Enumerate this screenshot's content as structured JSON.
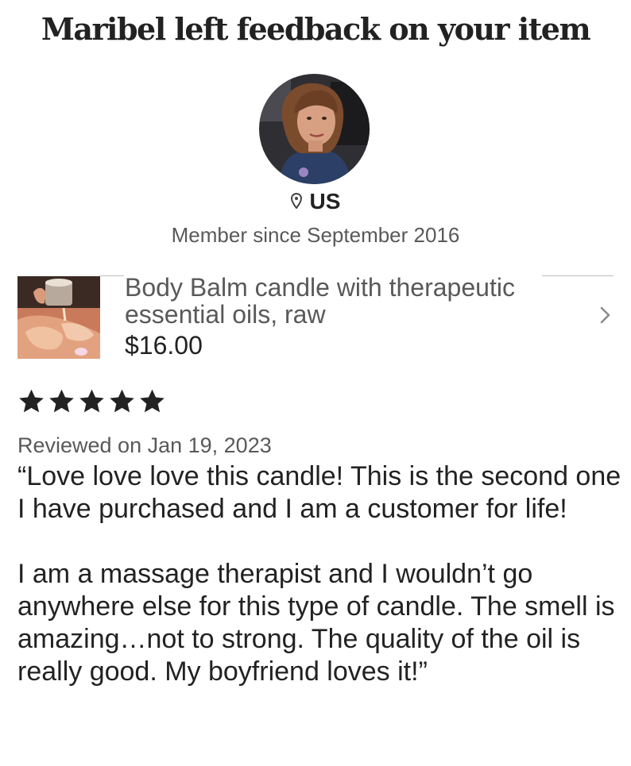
{
  "header": {
    "title": "Maribel left feedback on your item"
  },
  "reviewer": {
    "avatar": "profile-photo",
    "location": "US",
    "member_since": "Member since September 2016"
  },
  "item": {
    "title": "Body Balm candle with therapeutic essential oils, raw",
    "price": "$16.00",
    "thumbnail": "candle-massage-photo"
  },
  "review": {
    "rating": 5,
    "rating_max": 5,
    "reviewed_on": "Reviewed on Jan 19, 2023",
    "paragraph1": "“Love love love this candle!  This is the second one I have purchased and I am a customer for life!",
    "paragraph2": "I am a massage therapist and I wouldn’t go anywhere else for this type of candle. The smell is amazing…not to strong.  The quality of the oil is really good.  My boyfriend loves it!”"
  },
  "icons": {
    "location": "map-pin-icon",
    "chevron": "chevron-right-icon",
    "star": "star-icon"
  },
  "colors": {
    "text_primary": "#222222",
    "text_secondary": "#595959",
    "divider": "#bdbdbd"
  }
}
